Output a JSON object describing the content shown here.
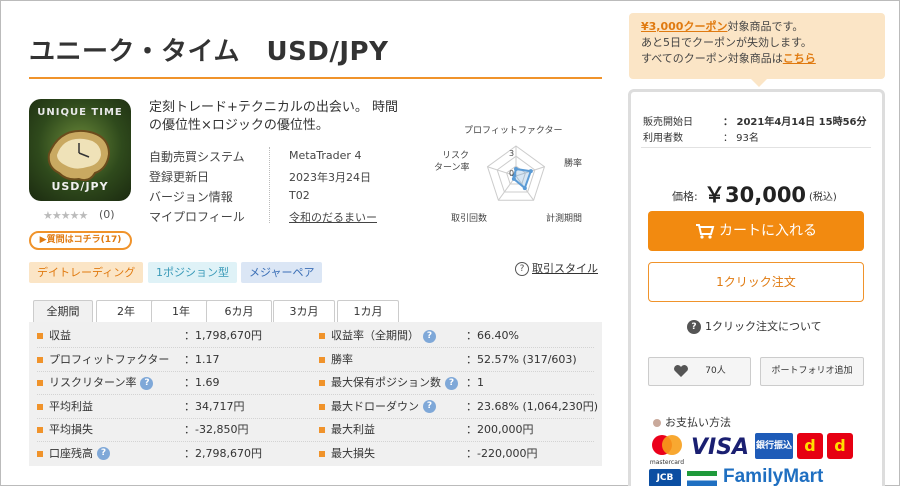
{
  "product": {
    "title": "ユニーク・タイム　USD/JPY",
    "logo_top_text": "UNIQUE TIME",
    "logo_bottom_text": "USD/JPY",
    "stars": "★★★★★",
    "rating_count": "(0)",
    "qa_button": "▶質問はコチラ(17)",
    "description": "定刻トレード+テクニカルの出会い。 時間の優位性×ロジックの優位性。"
  },
  "info": {
    "labels": [
      "自動売買システム",
      "登録更新日",
      "バージョン情報",
      "マイプロフィール"
    ],
    "values": [
      "MetaTrader 4",
      "2023年3月24日",
      "T02",
      "令和のだるまいー"
    ]
  },
  "radar": {
    "labels": [
      "プロフィットファクター",
      "勝率",
      "計測期間",
      "取引回数",
      "リスク\nターン率"
    ],
    "label_lines": {
      "risk_1": "リスク",
      "risk_2": "ターン率"
    },
    "scale_labels": [
      "3",
      "0"
    ],
    "values": [
      1.17,
      2.6,
      2.5,
      0.6,
      0.3
    ],
    "max": 5,
    "accent": "#5b9bd5"
  },
  "tags": [
    {
      "label": "デイトレーディング",
      "bg": "#fbe5c6",
      "color": "#e07a10"
    },
    {
      "label": "1ポジション型",
      "bg": "#dff2f7",
      "color": "#3a9ab8"
    },
    {
      "label": "メジャーペア",
      "bg": "#dbe6f5",
      "color": "#3b6fb6"
    }
  ],
  "trade_style": {
    "icon": "?",
    "label": "取引スタイル"
  },
  "tabs": [
    "全期間",
    "2年",
    "1年",
    "6カ月",
    "3カ月",
    "1カ月"
  ],
  "stats_left": [
    {
      "label": "収益",
      "value": "：1,798,670円",
      "help": false
    },
    {
      "label": "プロフィットファクター",
      "value": "：1.17",
      "help": false
    },
    {
      "label": "リスクリターン率",
      "value": "：1.69",
      "help": true
    },
    {
      "label": "平均利益",
      "value": "：34,717円",
      "help": false
    },
    {
      "label": "平均損失",
      "value": "：-32,850円",
      "help": false
    },
    {
      "label": "口座残高",
      "value": "：2,798,670円",
      "help": true
    }
  ],
  "stats_right": [
    {
      "label": "収益率（全期間）",
      "value": "：66.40%",
      "help": true
    },
    {
      "label": "勝率",
      "value": "：52.57% (317/603)",
      "help": false
    },
    {
      "label": "最大保有ポジション数",
      "value": "：1",
      "help": true
    },
    {
      "label": "最大ドローダウン",
      "value": "：23.68% (1,064,230円)",
      "help": true
    },
    {
      "label": "最大利益",
      "value": "：200,000円",
      "help": false
    },
    {
      "label": "最大損失",
      "value": "：-220,000円",
      "help": false
    }
  ],
  "coupon": {
    "link1": "¥3,000クーポン",
    "text1": "対象商品です。",
    "line2": "あと5日でクーポンが失効します。",
    "text3": "すべてのクーポン対象商品は",
    "link3": "こちら"
  },
  "sidebar": {
    "sale_start_label": "販売開始日",
    "sale_start_value": "：  2021年4月14日  15時56分",
    "users_label": "利用者数",
    "users_value": "：  93名",
    "price_label": "価格:",
    "price_value": "￥30,000",
    "price_tax": "(税込)",
    "cart_button": "カートに入れる",
    "one_click_button": "1クリック注文",
    "one_click_help": "1クリック注文について",
    "favorite_count": "70人",
    "portfolio_button": "ポートフォリオ追加",
    "payment_title": "お支払い方法",
    "payment_logos": [
      "mastercard",
      "VISA",
      "銀行振込",
      "d",
      "d",
      "JCB",
      "FamilyMart"
    ]
  },
  "colors": {
    "accent": "#f0932b",
    "cart": "#f28a10",
    "help": "#7fa8d8"
  }
}
